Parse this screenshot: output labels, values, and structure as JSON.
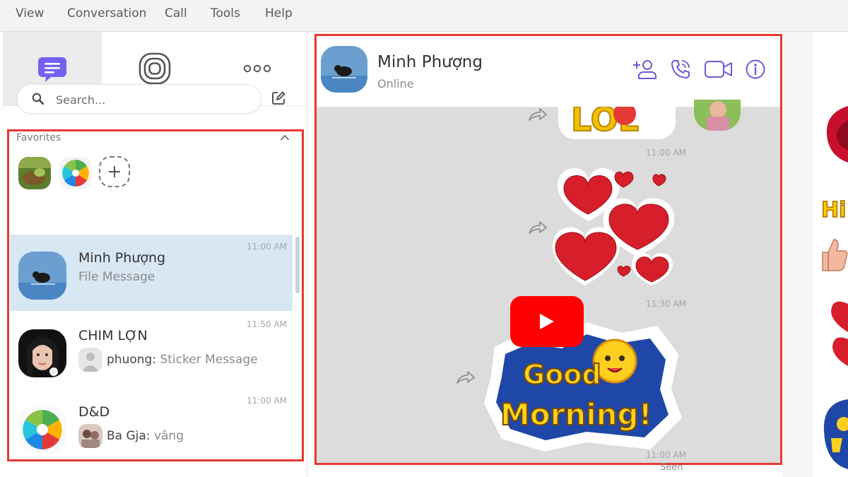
{
  "menu": [
    "View",
    "Conversation",
    "Call",
    "Tools",
    "Help"
  ],
  "search": {
    "placeholder": "Search..."
  },
  "favorites": {
    "title": "Favorites"
  },
  "chats": [
    {
      "name": "Minh Phượng",
      "preview": "File Message",
      "time": "11:00 AM"
    },
    {
      "name": "CHIM LỢN",
      "sender": "phuong:",
      "preview": "Sticker Message",
      "time": "11:50 AM"
    },
    {
      "name": "D&D",
      "sender": "Ba Gja:",
      "preview": "vâng",
      "time": "11:00 AM"
    }
  ],
  "conversation": {
    "name": "Minh Phượng",
    "status": "Online",
    "messages": [
      {
        "time": "11:00 AM"
      },
      {
        "time": "11:30 AM"
      },
      {
        "time": "11:00 AM"
      }
    ],
    "seen": "Seen"
  },
  "stickers": {
    "lol": "LOL",
    "good_morning_1": "Good",
    "good_morning_2": "Morning!",
    "hi": "Hi"
  },
  "colors": {
    "accent": "#7360f2",
    "highlight_border": "#e53935",
    "selected_row": "#d8e7f4",
    "youtube_red": "#ff0000"
  }
}
